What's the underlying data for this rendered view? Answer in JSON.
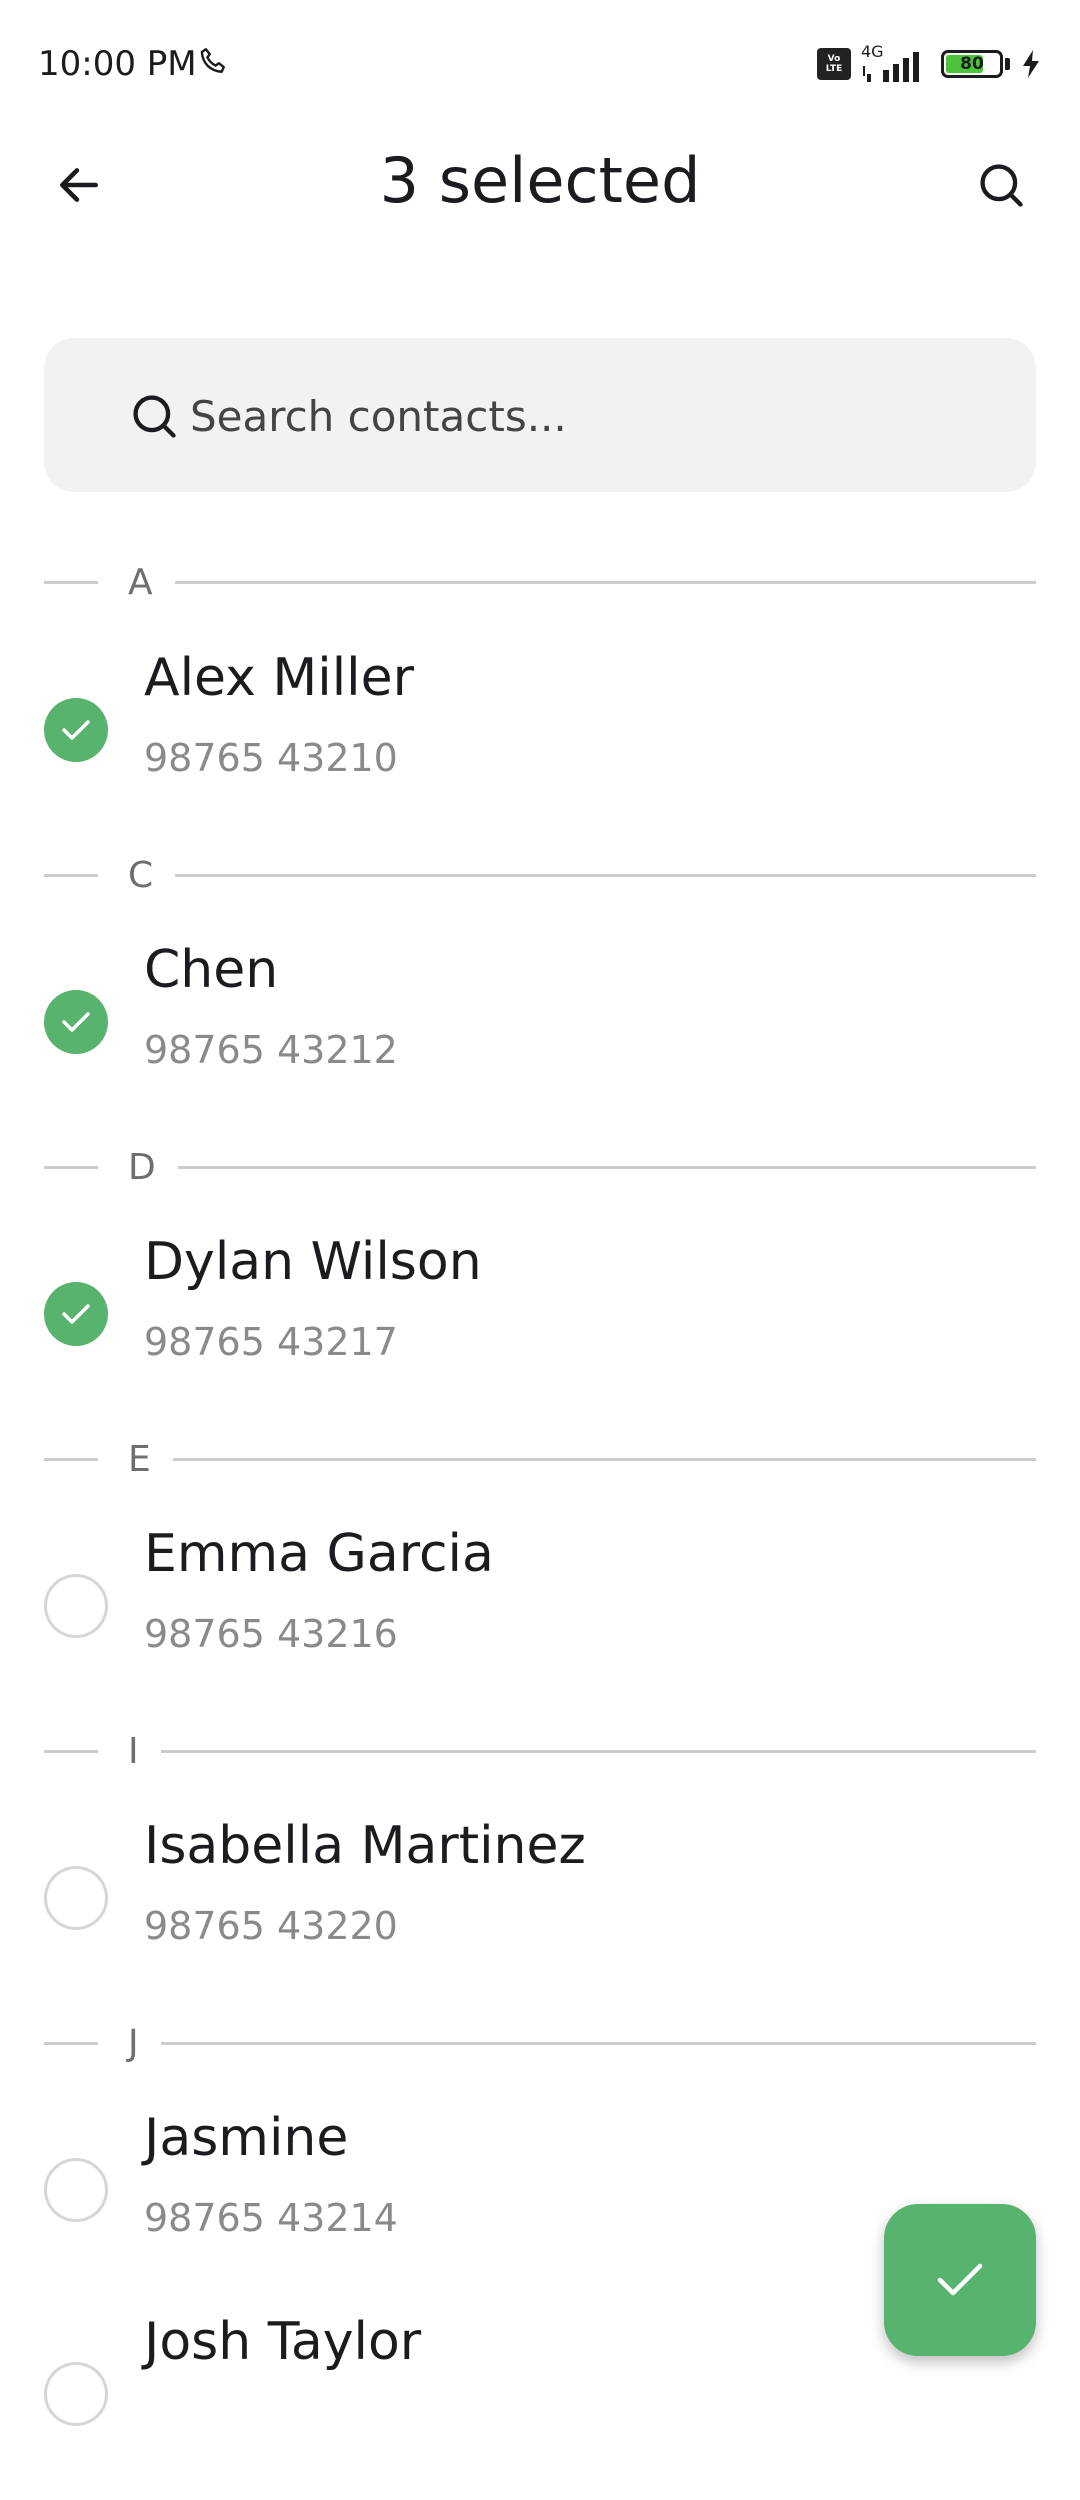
{
  "status_bar": {
    "time": "10:00 PM",
    "network": "4G",
    "volte_line1": "Vo",
    "volte_line2": "LTE",
    "battery_level": "80",
    "battery_fraction": 0.8,
    "battery_color": "#4cc33b"
  },
  "app_bar": {
    "title": "3 selected",
    "back_icon": "arrow-left-icon",
    "search_icon": "search-icon"
  },
  "search": {
    "placeholder": "Search contacts...",
    "value": ""
  },
  "accent_color": "#58b36f",
  "sections": [
    {
      "letter": "A",
      "contacts": [
        {
          "name": "Alex Miller",
          "phone": "98765 43210",
          "selected": true
        }
      ]
    },
    {
      "letter": "C",
      "contacts": [
        {
          "name": "Chen",
          "phone": "98765 43212",
          "selected": true
        }
      ]
    },
    {
      "letter": "D",
      "contacts": [
        {
          "name": "Dylan Wilson",
          "phone": "98765 43217",
          "selected": true
        }
      ]
    },
    {
      "letter": "E",
      "contacts": [
        {
          "name": "Emma Garcia",
          "phone": "98765 43216",
          "selected": false
        }
      ]
    },
    {
      "letter": "I",
      "contacts": [
        {
          "name": "Isabella Martinez",
          "phone": "98765 43220",
          "selected": false
        }
      ]
    },
    {
      "letter": "J",
      "contacts": [
        {
          "name": "Jasmine",
          "phone": "98765 43214",
          "selected": false
        },
        {
          "name": "Josh Taylor",
          "phone": "",
          "selected": false
        }
      ]
    }
  ],
  "fab": {
    "icon": "check-icon"
  }
}
